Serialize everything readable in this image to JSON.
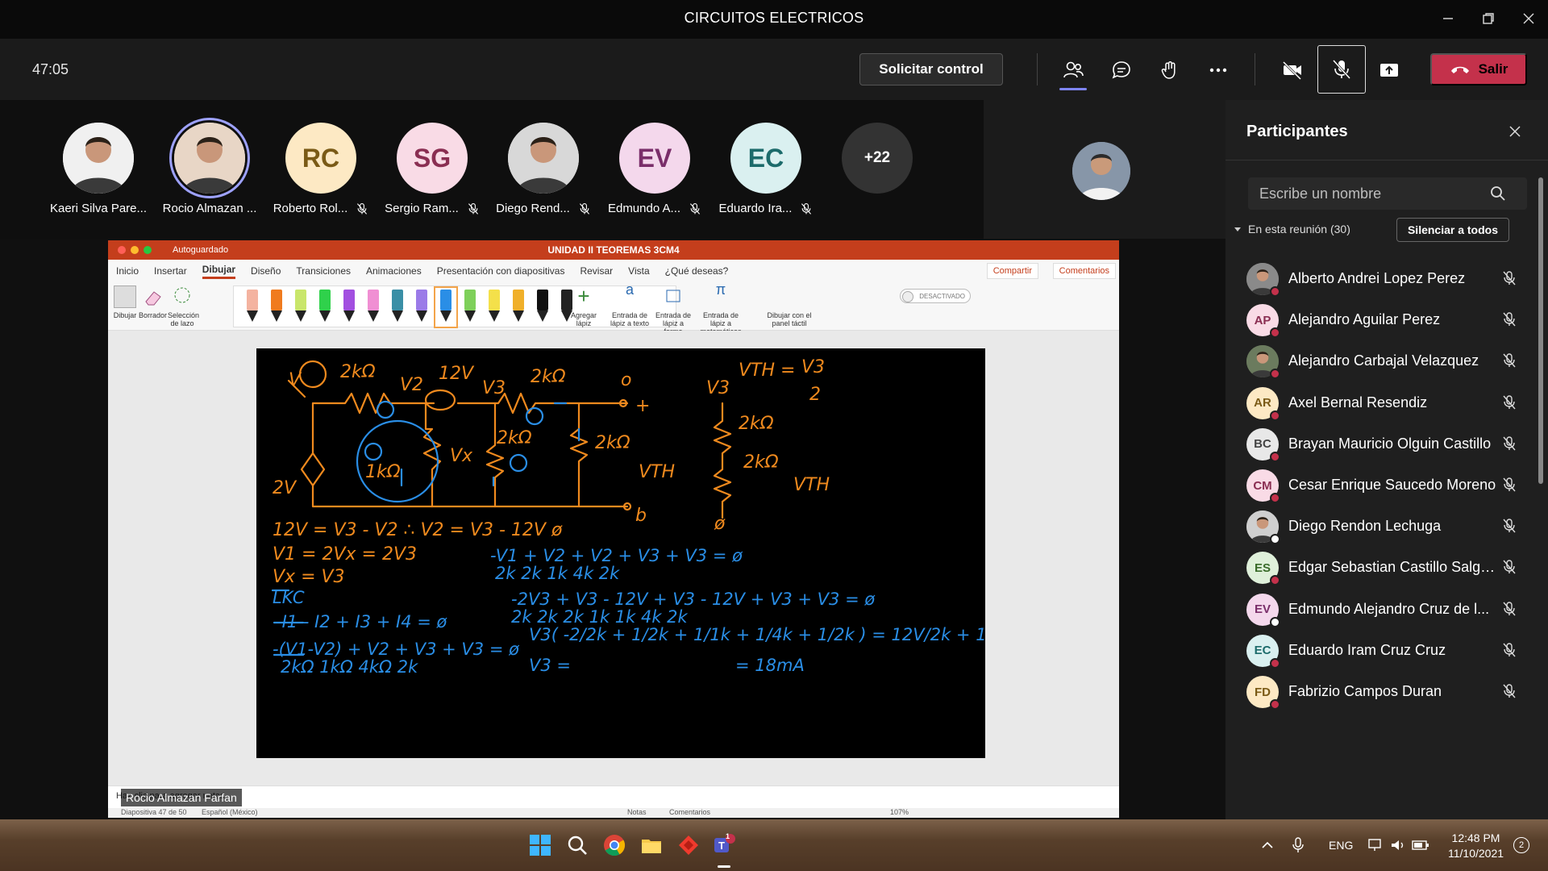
{
  "window": {
    "title": "CIRCUITOS ELECTRICOS"
  },
  "toolbar": {
    "timer": "47:05",
    "request_control": "Solicitar control",
    "leave_label": "Salir",
    "accent": "#7f85f5",
    "leave_color": "#c4314b"
  },
  "strip": {
    "participants": [
      {
        "name": "Kaeri Silva Pare...",
        "initials": "",
        "avatar_color": "#f0f0f0",
        "photo": true,
        "muted": false
      },
      {
        "name": "Rocio Almazan ...",
        "initials": "",
        "avatar_color": "#e8d6c6",
        "photo": true,
        "muted": false,
        "speaking": true
      },
      {
        "name": "Roberto Rol...",
        "initials": "RC",
        "avatar_color": "#fde9c4",
        "text_color": "#7a5a16",
        "muted": true
      },
      {
        "name": "Sergio Ram...",
        "initials": "SG",
        "avatar_color": "#f9dbe6",
        "text_color": "#8a2e52",
        "muted": true
      },
      {
        "name": "Diego Rend...",
        "initials": "",
        "avatar_color": "#d8d8d8",
        "photo": true,
        "muted": true
      },
      {
        "name": "Edmundo A...",
        "initials": "EV",
        "avatar_color": "#f4d8ec",
        "text_color": "#7a2e6a",
        "muted": true
      },
      {
        "name": "Eduardo Ira...",
        "initials": "EC",
        "avatar_color": "#daf0f0",
        "text_color": "#1c6b6b",
        "muted": true
      }
    ],
    "more_count": "+22"
  },
  "ppt": {
    "autosave_label": "Autoguardado",
    "doc_title": "UNIDAD II TEOREMAS 3CM4",
    "tabs": [
      "Inicio",
      "Insertar",
      "Dibujar",
      "Diseño",
      "Transiciones",
      "Animaciones",
      "Presentación con diapositivas",
      "Revisar",
      "Vista"
    ],
    "active_tab": "Dibujar",
    "tell_me": "¿Qué deseas?",
    "share": "Compartir",
    "comments": "Comentarios",
    "tools": {
      "draw": "Dibujar",
      "eraser": "Borrador",
      "lasso": "Selección de lazo",
      "add_pen": "Agregar lápiz",
      "ink_text": "Entrada de lápiz a texto",
      "ink_shape": "Entrada de lápiz a forma",
      "ink_math": "Entrada de lápiz a matemáticas",
      "toggle": "DESACTIVADO",
      "touch": "Dibujar con el panel táctil"
    },
    "pen_colors": [
      "#f4b3a0",
      "#f07b1e",
      "#c9e66b",
      "#2fd14b",
      "#a24fe0",
      "#f08fd3",
      "#3a8fa6",
      "#9b7be8",
      "#2a8ee6",
      "#7ed05a",
      "#f4e04a",
      "#f0b02a",
      "#111111",
      "#222222"
    ],
    "notes_placeholder": "Haz clic para agregar notas",
    "status": {
      "slide": "Diapositiva 47 de 50",
      "lang": "Español (México)",
      "notes": "Notas",
      "comments": "Comentarios",
      "zoom": "107%"
    },
    "presenter": "Rocio Almazan Farfan"
  },
  "panel": {
    "title": "Participantes",
    "search_placeholder": "Escribe un nombre",
    "section": "En esta reunión (30)",
    "mute_all": "Silenciar a todos",
    "people": [
      {
        "name": "Alberto Andrei Lopez Perez",
        "initials": "",
        "photo": true,
        "color": "#8a8a8a",
        "status": "busy"
      },
      {
        "name": "Alejandro Aguilar Perez",
        "initials": "AP",
        "color": "#f9dbe6",
        "text": "#8a2e52",
        "status": "busy"
      },
      {
        "name": "Alejandro Carbajal Velazquez",
        "initials": "",
        "photo": true,
        "color": "#6b7b5e",
        "status": "busy"
      },
      {
        "name": "Axel Bernal Resendiz",
        "initials": "AR",
        "color": "#fde9c4",
        "text": "#7a5a16",
        "status": "busy"
      },
      {
        "name": "Brayan Mauricio Olguin Castillo",
        "initials": "BC",
        "color": "#e8e8e8",
        "text": "#444444",
        "status": "busy"
      },
      {
        "name": "Cesar Enrique Saucedo Moreno",
        "initials": "CM",
        "color": "#f9dbe6",
        "text": "#8a2e52",
        "status": "busy"
      },
      {
        "name": "Diego Rendon Lechuga",
        "initials": "",
        "photo": true,
        "color": "#cfcfcf",
        "status": "away"
      },
      {
        "name": "Edgar Sebastian Castillo Salga...",
        "initials": "ES",
        "color": "#dff0da",
        "text": "#3a6b2a",
        "status": "busy"
      },
      {
        "name": "Edmundo Alejandro Cruz de l...",
        "initials": "EV",
        "color": "#f4d8ec",
        "text": "#7a2e6a",
        "status": "away"
      },
      {
        "name": "Eduardo Iram Cruz Cruz",
        "initials": "EC",
        "color": "#daf0f0",
        "text": "#1c6b6b",
        "status": "busy"
      },
      {
        "name": "Fabrizio Campos Duran",
        "initials": "FD",
        "color": "#fde9c4",
        "text": "#7a5a16",
        "status": "busy"
      }
    ]
  },
  "taskbar": {
    "lang": "ENG",
    "time": "12:48 PM",
    "date": "11/10/2021",
    "notif_count": "2",
    "teams_badge": "1"
  }
}
